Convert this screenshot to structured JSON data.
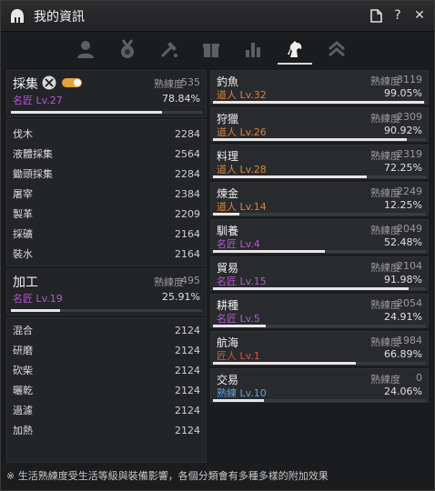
{
  "title": "我的資訊",
  "icons": {
    "title": "helmet-icon",
    "controls": [
      "document-icon",
      "help-icon",
      "close-icon"
    ],
    "tabs": [
      "person-icon",
      "medal-icon",
      "tools-icon",
      "gift-icon",
      "bar-chart-icon",
      "horse-icon",
      "rank-chevron-icon"
    ]
  },
  "gathering": {
    "name": "採集",
    "label": "熟練度",
    "value": "535",
    "rank": "名匠 Lv.27",
    "percent": "78.84%",
    "progress": 0.7884,
    "items": [
      {
        "name": "伐木",
        "value": "2284"
      },
      {
        "name": "液體採集",
        "value": "2564"
      },
      {
        "name": "鋤頭採集",
        "value": "2284"
      },
      {
        "name": "屠宰",
        "value": "2384"
      },
      {
        "name": "製革",
        "value": "2209"
      },
      {
        "name": "採礦",
        "value": "2164"
      },
      {
        "name": "裝水",
        "value": "2164"
      }
    ]
  },
  "processing": {
    "name": "加工",
    "label": "熟練度",
    "value": "495",
    "rank": "名匠 Lv.19",
    "percent": "25.91%",
    "progress": 0.2591,
    "items": [
      {
        "name": "混合",
        "value": "2124"
      },
      {
        "name": "研磨",
        "value": "2124"
      },
      {
        "name": "砍柴",
        "value": "2124"
      },
      {
        "name": "曬乾",
        "value": "2124"
      },
      {
        "name": "過濾",
        "value": "2124"
      },
      {
        "name": "加熱",
        "value": "2124"
      }
    ]
  },
  "life_skills": [
    {
      "name": "釣魚",
      "label": "熟練度",
      "value": "3119",
      "rank": "道人 Lv.32",
      "rank_color": "orange",
      "percent": "99.05%",
      "progress": 0.9905
    },
    {
      "name": "狩獵",
      "label": "熟練度",
      "value": "2309",
      "rank": "道人 Lv.26",
      "rank_color": "orange",
      "percent": "90.92%",
      "progress": 0.9092
    },
    {
      "name": "料理",
      "label": "熟練度",
      "value": "2319",
      "rank": "道人 Lv.28",
      "rank_color": "orange",
      "percent": "72.25%",
      "progress": 0.7225
    },
    {
      "name": "煉金",
      "label": "熟練度",
      "value": "2249",
      "rank": "道人 Lv.14",
      "rank_color": "orange",
      "percent": "12.25%",
      "progress": 0.1225
    },
    {
      "name": "馴養",
      "label": "熟練度",
      "value": "2049",
      "rank": "名匠 Lv.4",
      "rank_color": "purple",
      "percent": "52.48%",
      "progress": 0.5248
    },
    {
      "name": "貿易",
      "label": "熟練度",
      "value": "2104",
      "rank": "名匠 Lv.15",
      "rank_color": "purple",
      "percent": "91.98%",
      "progress": 0.9198
    },
    {
      "name": "耕種",
      "label": "熟練度",
      "value": "2054",
      "rank": "名匠 Lv.5",
      "rank_color": "purple",
      "percent": "24.91%",
      "progress": 0.2491
    },
    {
      "name": "航海",
      "label": "熟練度",
      "value": "1984",
      "rank": "匠人 Lv.1",
      "rank_color": "red",
      "percent": "66.89%",
      "progress": 0.6689
    },
    {
      "name": "交易",
      "label": "熟練度",
      "value": "0",
      "rank": "熟練 Lv.10",
      "rank_color": "blue",
      "percent": "24.06%",
      "progress": 0.2406
    }
  ],
  "footer": "※ 生活熟練度受生活等級與裝備影響，各個分類會有多種多樣的附加效果",
  "colors": {
    "purple": "#b457d6",
    "orange": "#d9843c",
    "red": "#d9573c",
    "blue": "#5aa0e0",
    "toggle": "#e0a43c"
  }
}
